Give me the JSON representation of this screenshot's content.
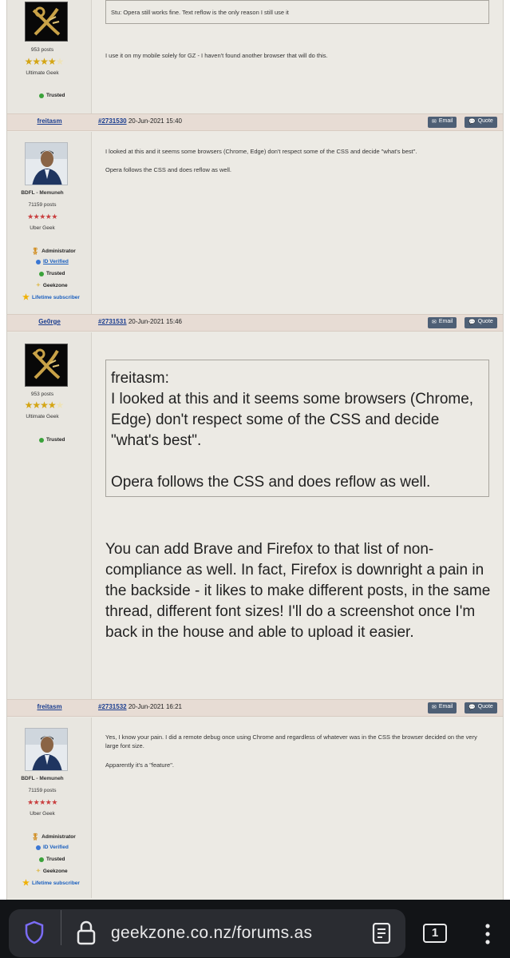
{
  "posts": [
    {
      "user": "",
      "posts_count": "953 posts",
      "rank": "Ultimate Geek",
      "badges": [
        "Trusted"
      ],
      "quote": "Stu: Opera still works fine. Text reflow is the only reason I still use it",
      "body": "I use it on my mobile solely for GZ - I haven't found another browser that will do this."
    },
    {
      "user": "freitasm",
      "post_id": "#2731530",
      "date": "20-Jun-2021 15:40",
      "title": "BDFL - Memuneh",
      "posts_count": "71159 posts",
      "rank": "Uber Geek",
      "badges": [
        "Administrator",
        "ID Verified",
        "Trusted",
        "Geekzone",
        "Lifetime subscriber"
      ],
      "body1": "I looked at this and it seems some browsers (Chrome, Edge) don't respect some of the CSS and decide \"what's best\".",
      "body2": "Opera follows the CSS and does reflow as well."
    },
    {
      "user": "Ge0rge",
      "post_id": "#2731531",
      "date": "20-Jun-2021 15:46",
      "posts_count": "953 posts",
      "rank": "Ultimate Geek",
      "badges": [
        "Trusted"
      ],
      "quote_author": "freitasm:",
      "quote_line1": "I looked at this and it seems some browsers (Chrome, Edge) don't respect some of the CSS and decide \"what's best\".",
      "quote_line2": "Opera follows the CSS and does reflow as well.",
      "body": "You can add Brave and Firefox to that list of non-compliance as well. In fact, Firefox is downright a pain in the backside - it likes to make different posts, in the same thread, different font sizes! I'll do a screenshot once I'm back in the house and able to upload it easier."
    },
    {
      "user": "freitasm",
      "post_id": "#2731532",
      "date": "20-Jun-2021 16:21",
      "title": "BDFL - Memuneh",
      "posts_count": "71159 posts",
      "rank": "Uber Geek",
      "badges": [
        "Administrator",
        "ID Verified",
        "Trusted",
        "Geekzone",
        "Lifetime subscriber"
      ],
      "body1": "Yes, I know your pain. I did a remote debug once using Chrome and regardless of whatever was in the CSS the browser decided on the very large font size.",
      "body2": "Apparently it's a \"feature\"."
    }
  ],
  "buttons": {
    "email": "Email",
    "quote": "Quote"
  },
  "browser": {
    "url": "geekzone.co.nz/forums.as",
    "tab_count": "1"
  },
  "colors": {
    "header_bg": "#e7dcd4",
    "button_bg": "#4e5f75",
    "link": "#1a3d8f",
    "page_bg": "#eceae4",
    "toolbar_bg": "#121417"
  }
}
